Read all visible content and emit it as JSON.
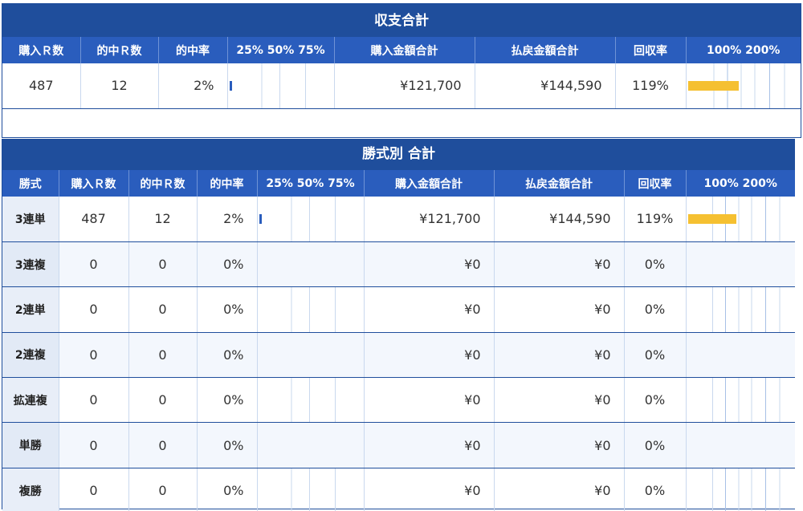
{
  "summary": {
    "title": "収支合計",
    "headers": {
      "bets": "購入Ｒ数",
      "hits": "的中Ｒ数",
      "hit_rate": "的中率",
      "hit_scale": "25% 50% 75%",
      "spent": "購入金額合計",
      "payout": "払戻金額合計",
      "return_rate": "回収率",
      "return_scale": "100% 200%"
    },
    "row": {
      "bets": "487",
      "hits": "12",
      "hit_rate": "2%",
      "hit_fraction": 0.02,
      "spent": "¥121,700",
      "payout": "¥144,590",
      "return_rate": "119%",
      "return_fraction": 1.19
    }
  },
  "by_type": {
    "title": "勝式別 合計",
    "headers": {
      "type": "勝式",
      "bets": "購入Ｒ数",
      "hits": "的中Ｒ数",
      "hit_rate": "的中率",
      "hit_scale": "25% 50% 75%",
      "spent": "購入金額合計",
      "payout": "払戻金額合計",
      "return_rate": "回収率",
      "return_scale": "100% 200%"
    },
    "rows": [
      {
        "type": "3連単",
        "bets": "487",
        "hits": "12",
        "hit_rate": "2%",
        "hit_fraction": 0.02,
        "spent": "¥121,700",
        "payout": "¥144,590",
        "return_rate": "119%",
        "return_fraction": 1.19
      },
      {
        "type": "3連複",
        "bets": "0",
        "hits": "0",
        "hit_rate": "0%",
        "hit_fraction": 0,
        "spent": "¥0",
        "payout": "¥0",
        "return_rate": "0%",
        "return_fraction": 0
      },
      {
        "type": "2連単",
        "bets": "0",
        "hits": "0",
        "hit_rate": "0%",
        "hit_fraction": 0,
        "spent": "¥0",
        "payout": "¥0",
        "return_rate": "0%",
        "return_fraction": 0
      },
      {
        "type": "2連複",
        "bets": "0",
        "hits": "0",
        "hit_rate": "0%",
        "hit_fraction": 0,
        "spent": "¥0",
        "payout": "¥0",
        "return_rate": "0%",
        "return_fraction": 0
      },
      {
        "type": "拡連複",
        "bets": "0",
        "hits": "0",
        "hit_rate": "0%",
        "hit_fraction": 0,
        "spent": "¥0",
        "payout": "¥0",
        "return_rate": "0%",
        "return_fraction": 0
      },
      {
        "type": "単勝",
        "bets": "0",
        "hits": "0",
        "hit_rate": "0%",
        "hit_fraction": 0,
        "spent": "¥0",
        "payout": "¥0",
        "return_rate": "0%",
        "return_fraction": 0
      },
      {
        "type": "複勝",
        "bets": "0",
        "hits": "0",
        "hit_rate": "0%",
        "hit_fraction": 0,
        "spent": "¥0",
        "payout": "¥0",
        "return_rate": "0%",
        "return_fraction": 0
      }
    ]
  },
  "colors": {
    "header_blue": "#2a5dbd",
    "title_blue": "#1f4e9c",
    "hit_bar": "#2a5dbd",
    "return_bar": "#f5c031"
  }
}
